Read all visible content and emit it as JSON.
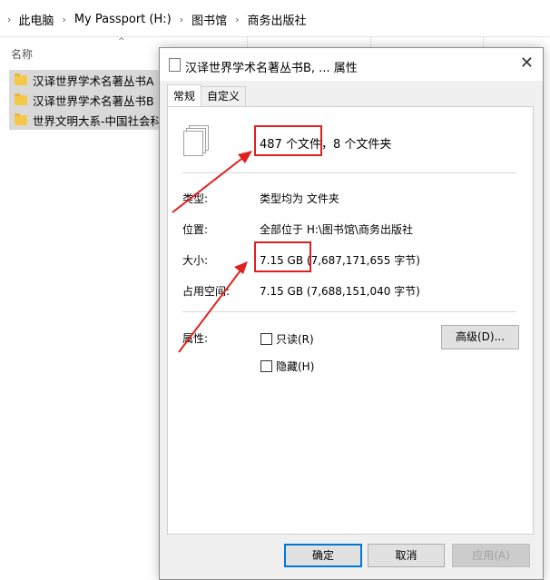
{
  "explorer": {
    "breadcrumb": [
      "此电脑",
      "My Passport (H:)",
      "图书馆",
      "商务出版社"
    ],
    "columns": {
      "name": "名称"
    },
    "files": [
      {
        "name": "汉译世界学术名著丛书A",
        "selected": true
      },
      {
        "name": "汉译世界学术名著丛书B",
        "selected": true
      },
      {
        "name": "世界文明大系-中国社会科学",
        "selected": true
      }
    ]
  },
  "dialog": {
    "title": "汉译世界学术名著丛书B, ... 属性",
    "tabs": [
      "常规",
      "自定义"
    ],
    "active_tab": "常规",
    "contents_highlight": "487 个文件，",
    "contents_rest": "8 个文件夹",
    "type_label": "类型:",
    "type_value": "类型均为 文件夹",
    "location_label": "位置:",
    "location_value": "全部位于 H:\\图书馆\\商务出版社",
    "size_label": "大小:",
    "size_highlight": "7.15 GB",
    "size_rest": "(7,687,171,655 字节)",
    "disk_label": "占用空间:",
    "disk_value": "7.15 GB (7,688,151,040 字节)",
    "attributes_label": "属性:",
    "readonly_label": "只读(R)",
    "hidden_label": "隐藏(H)",
    "advanced_button": "高级(D)...",
    "ok_button": "确定",
    "cancel_button": "取消",
    "apply_button": "应用(A)"
  },
  "colors": {
    "annotation": "#e02020",
    "ok_border": "#0078d7",
    "folder": "#f5c84a"
  }
}
